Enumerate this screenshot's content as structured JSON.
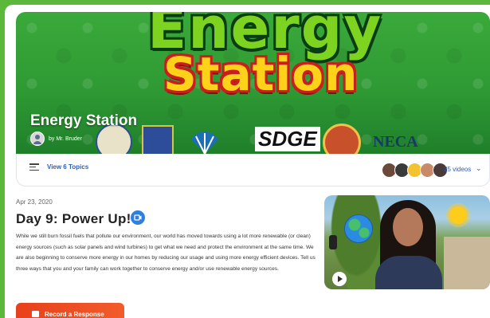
{
  "banner": {
    "logo_line1": "Energy",
    "logo_line2": "Station",
    "title": "Energy Station",
    "author": "by Mr. Bruder",
    "sponsor_sdge": "SDGE",
    "sponsor_neca": "NECA"
  },
  "topics": {
    "link_label": "View 6 Topics",
    "videos_count": "25 videos"
  },
  "post": {
    "date": "Apr 23, 2020",
    "title": "Day 9: Power Up!",
    "description": "While we still burn fossil fuels that pollute our environment, our world has moved  towards using a lot more renewable (or clean) energy sources (such as solar panels and wind turbines) to get what we need and protect the environment at the same time. We are also beginning to conserve more energy in our homes by reducing our usage and using more energy efficient devices. Tell us three ways that you and your family can work together to conserve energy and/or use renewable energy sources.",
    "record_button": "Record a Response"
  },
  "colors": {
    "link": "#2b5fb8",
    "record_button": "#e8401c",
    "badge": "#2e7fe0"
  }
}
